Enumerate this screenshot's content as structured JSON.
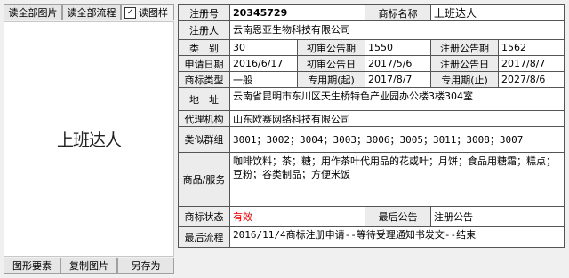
{
  "toolbar": {
    "read_all_images": "读全部图片",
    "read_all_process": "读全部流程",
    "read_sample_checkbox_label": "读图样",
    "read_sample_checked": true
  },
  "preview": {
    "mark_text": "上班达人"
  },
  "bottom_buttons": {
    "elements": "图形要素",
    "copy_image": "复制图片",
    "save_as": "另存为"
  },
  "record": {
    "reg_no_label": "注册号",
    "reg_no": "20345729",
    "mark_name_label": "商标名称",
    "mark_name": "上班达人",
    "applicant_label": "注册人",
    "applicant": "云南恩亚生物科技有限公司",
    "class_label": "类　别",
    "class_value": "30",
    "prelim_issue_label": "初审公告期",
    "prelim_issue_value": "1550",
    "reg_issue_label": "注册公告期",
    "reg_issue_value": "1562",
    "apply_date_label": "申请日期",
    "apply_date_value": "2016/6/17",
    "prelim_date_label": "初审公告日",
    "prelim_date_value": "2017/5/6",
    "reg_date_label": "注册公告日",
    "reg_date_value": "2017/8/7",
    "mark_type_label": "商标类型",
    "mark_type_value": "一般",
    "excl_start_label": "专用期(起)",
    "excl_start_value": "2017/8/7",
    "excl_end_label": "专用期(止)",
    "excl_end_value": "2027/8/6",
    "address_label": "地　址",
    "address_value": "云南省昆明市东川区天生桥特色产业园办公楼3楼304室",
    "agent_label": "代理机构",
    "agent_value": "山东欧赛网络科技有限公司",
    "similar_group_label": "类似群组",
    "similar_group_value": "3001；3002；3004；3003；3006；3005；3011；3008；3007",
    "goods_label": "商品/服务",
    "goods_value": "咖啡饮料；茶；糖；用作茶叶代用品的花或叶；月饼；食品用糖霜；糕点；豆粉；谷类制品；方便米饭",
    "status_label": "商标状态",
    "status_value": "有效",
    "latest_notice_label": "最后公告",
    "latest_notice_value": "注册公告",
    "latest_process_label": "最后流程",
    "latest_process_value": "2016/11/4商标注册申请--等待受理通知书发文--结束"
  }
}
